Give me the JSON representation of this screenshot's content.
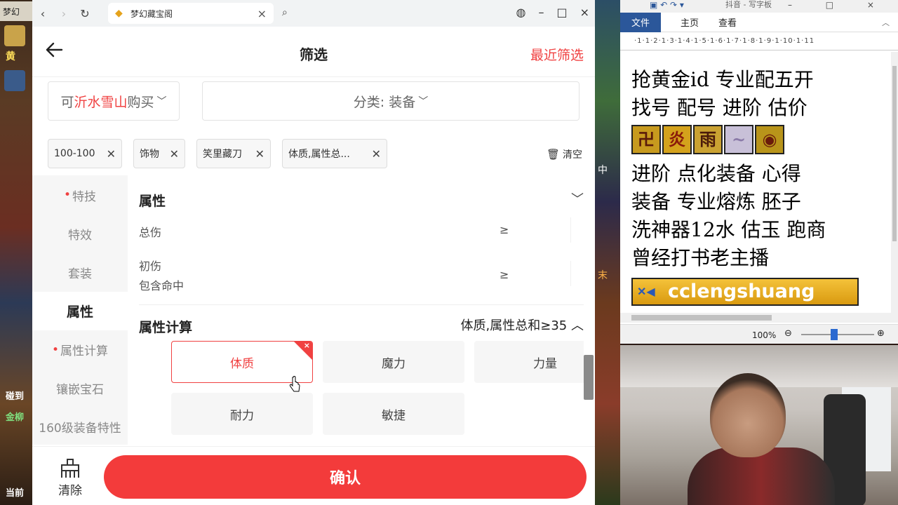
{
  "game_left": {
    "tab_title": "梦幻",
    "label_1": "黄",
    "label_2": "碰到",
    "label_3": "金柳",
    "label_4": "当前"
  },
  "browser": {
    "tab_title": "梦幻藏宝阁",
    "nav": {
      "back_icon": "chevron-left-icon",
      "forward_icon": "chevron-right-icon",
      "reload_icon": "reload-icon",
      "search_icon": "search-icon"
    }
  },
  "header": {
    "title": "筛选",
    "recent_filter": "最近筛选"
  },
  "selectors": {
    "server_prefix": "可",
    "server_name": "沂水雪山",
    "server_suffix": "购买",
    "category": "分类: 装备"
  },
  "chips": [
    {
      "label": "100-100"
    },
    {
      "label": "饰物"
    },
    {
      "label": "笑里藏刀"
    },
    {
      "label": "体质,属性总..."
    }
  ],
  "clear_all": "清空",
  "side_nav": [
    {
      "label": "特技",
      "dot": true,
      "active": false
    },
    {
      "label": "特效",
      "dot": false,
      "active": false
    },
    {
      "label": "套装",
      "dot": false,
      "active": false
    },
    {
      "label": "属性",
      "dot": false,
      "active": true
    },
    {
      "label": "属性计算",
      "dot": true,
      "active": false
    },
    {
      "label": "镶嵌宝石",
      "dot": false,
      "active": false
    },
    {
      "label": "160级装备特性",
      "dot": false,
      "active": false
    }
  ],
  "attributes": {
    "title": "属性",
    "rows": [
      {
        "label": "总伤",
        "sub": "",
        "op": "≥",
        "value": ""
      },
      {
        "label": "初伤",
        "sub": "包含命中",
        "op": "≥",
        "value": ""
      }
    ]
  },
  "attr_calc": {
    "title": "属性计算",
    "summary": "体质,属性总和≥35",
    "options": [
      {
        "label": "体质",
        "selected": true
      },
      {
        "label": "魔力",
        "selected": false
      },
      {
        "label": "力量",
        "selected": false
      },
      {
        "label": "耐力",
        "selected": false
      },
      {
        "label": "敏捷",
        "selected": false
      }
    ]
  },
  "footer": {
    "reset_label": "清除",
    "confirm_label": "确认"
  },
  "game_mid": {
    "label_1": "中",
    "label_2": "末"
  },
  "wordpad": {
    "title": "抖音 - 写字板",
    "ribbon": [
      "文件",
      "主页",
      "查看"
    ],
    "ruler": "·1·1·2·1·3·1·4·1·5·1·6·1·7·1·8·1·9·1·10·1·11",
    "lines": [
      "抢黄金id 专业配五开",
      "找号 配号 进阶 估价",
      "进阶 点化装备 心得",
      "装备 专业熔炼 胚子",
      "洗神器12水 估玉 跑商",
      "曾经打书老主播"
    ],
    "banner_text": "cclengshuang",
    "zoom": "100%"
  }
}
